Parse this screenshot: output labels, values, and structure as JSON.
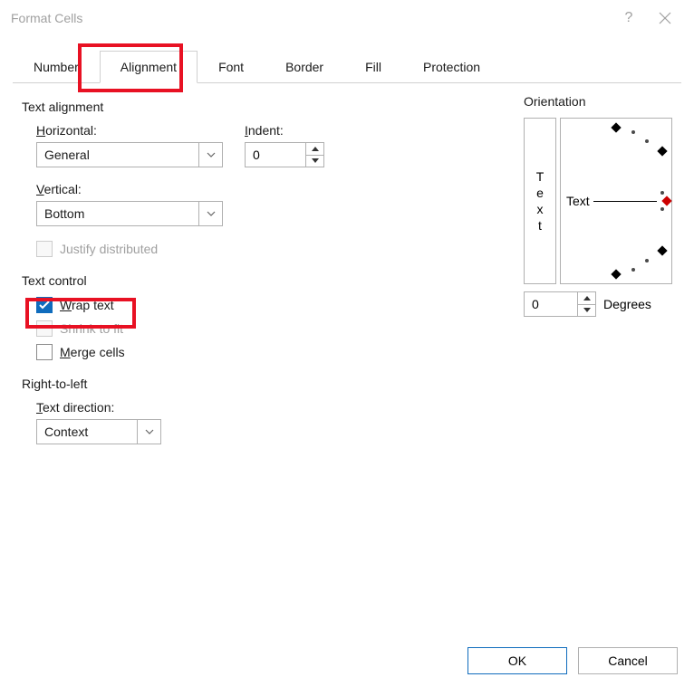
{
  "titlebar": {
    "title": "Format Cells",
    "help": "?",
    "close": "×"
  },
  "tabs": {
    "number": "Number",
    "alignment": "Alignment",
    "font": "Font",
    "border": "Border",
    "fill": "Fill",
    "protection": "Protection"
  },
  "text_alignment": {
    "heading": "Text alignment",
    "horizontal_prefix": "H",
    "horizontal_rest": "orizontal:",
    "horizontal_value": "General",
    "vertical_prefix": "V",
    "vertical_rest": "ertical:",
    "vertical_value": "Bottom",
    "indent_prefix": "I",
    "indent_rest": "ndent:",
    "indent_value": "0",
    "justify_label": "Justify distributed"
  },
  "text_control": {
    "heading": "Text control",
    "wrap_prefix": "W",
    "wrap_rest": "rap text",
    "shrink_label": "Shrink to fit",
    "merge_prefix": "M",
    "merge_rest": "erge cells"
  },
  "rtl": {
    "heading": "Right-to-left",
    "direction_prefix": "T",
    "direction_rest": "ext direction:",
    "direction_value": "Context"
  },
  "orientation": {
    "heading": "Orientation",
    "vtext_t": "T",
    "vtext_e": "e",
    "vtext_x": "x",
    "vtext_t2": "t",
    "dial_label": "Text",
    "degrees_value": "0",
    "degrees_prefix": "D",
    "degrees_rest": "egrees"
  },
  "buttons": {
    "ok": "OK",
    "cancel": "Cancel"
  }
}
